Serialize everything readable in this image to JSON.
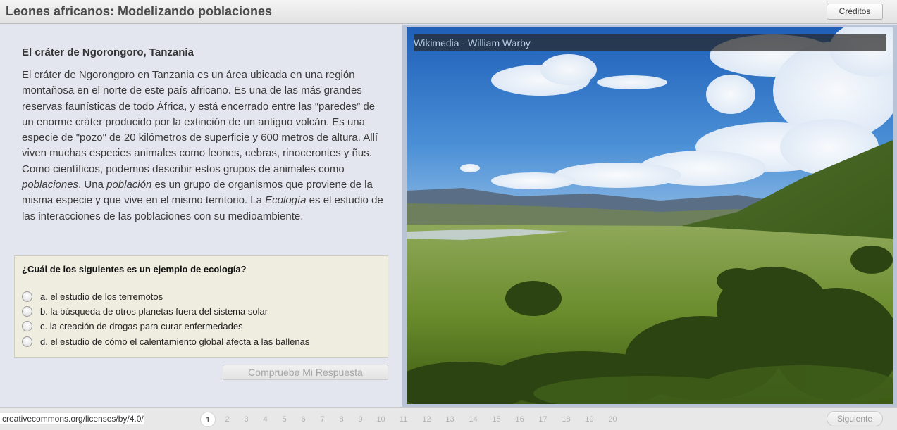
{
  "header": {
    "title": "Leones africanos: Modelizando poblaciones",
    "credits_label": "Créditos"
  },
  "content": {
    "section_title": "El cráter de Ngorongoro, Tanzania",
    "paragraph_parts": [
      "El cráter de Ngorongoro en Tanzania es un área ubicada en una región montañosa en el norte de este país africano. Es una de las más grandes reservas faunísticas de todo África, y está encerrado entre las “paredes” de un enorme cráter producido por la extinción de un antiguo volcán. Es una especie de \"pozo\" de 20 kilómetros de superficie y 600 metros de altura. Allí viven muchas especies animales como leones, cebras, rinocerontes y ñus. Como científicos, podemos describir estos grupos de animales como ",
      "poblaciones",
      ". Una ",
      "población",
      " es un grupo de organismos que proviene de la misma especie y que vive en el mismo territorio. La ",
      "Ecología",
      " es el estudio de las interacciones de las poblaciones con su medioambiente."
    ]
  },
  "quiz": {
    "question": "¿Cuál de los siguientes es un ejemplo de ecología?",
    "options": [
      "a. el estudio de los terremotos",
      "b. la búsqueda de otros planetas fuera del sistema solar",
      "c. la creación de drogas para curar enfermedades",
      "d. el estudio de cómo el calentamiento global afecta a las ballenas"
    ],
    "check_label": "Compruebe Mi Respuesta"
  },
  "image": {
    "caption": "Wikimedia - William Warby",
    "icon": "landscape-photo"
  },
  "footer": {
    "license": "creativecommons.org/licenses/by/4.0/",
    "pages": [
      "1",
      "2",
      "3",
      "4",
      "5",
      "6",
      "7",
      "8",
      "9",
      "10",
      "11",
      "12",
      "13",
      "14",
      "15",
      "16",
      "17",
      "18",
      "19",
      "20"
    ],
    "current_page": "1",
    "next_label": "Siguiente"
  },
  "colors": {
    "accent_caption": "#b9cfe6",
    "quiz_bg": "#efede0",
    "panel_bg": "#e3e6ee"
  }
}
